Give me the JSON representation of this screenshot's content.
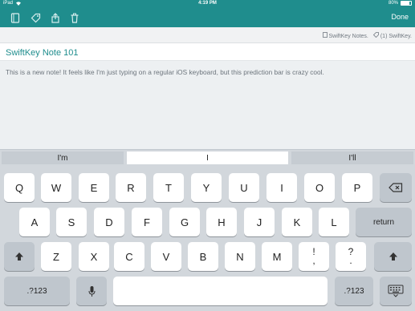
{
  "status": {
    "device": "iPad",
    "time": "4:19 PM",
    "battery": "80%",
    "battery_level": 0.8
  },
  "toolbar": {
    "icons": [
      "notebook-icon",
      "tag-icon",
      "share-icon",
      "trash-icon"
    ],
    "done_label": "Done"
  },
  "note_meta": {
    "notebook": "SwiftKey Notes.",
    "tags": "(1) SwiftKey."
  },
  "note": {
    "title": "SwiftKey Note 101",
    "body": "This is a new note! It feels like I'm just typing on a regular iOS keyboard, but this prediction bar is crazy cool."
  },
  "predictions": [
    "I'm",
    "I",
    "I'll"
  ],
  "keyboard": {
    "row1": [
      "Q",
      "W",
      "E",
      "R",
      "T",
      "Y",
      "U",
      "I",
      "O",
      "P"
    ],
    "row2": [
      "A",
      "S",
      "D",
      "F",
      "G",
      "H",
      "J",
      "K",
      "L"
    ],
    "return_label": "return",
    "row3": [
      "Z",
      "X",
      "C",
      "V",
      "B",
      "N",
      "M"
    ],
    "punct1_top": "!",
    "punct1_bottom": ",",
    "punct2_top": "?",
    "punct2_bottom": ".",
    "numbers_label": ".?123"
  },
  "colors": {
    "accent": "#1f8d8d",
    "keyboard_bg": "#d2d7dc"
  }
}
